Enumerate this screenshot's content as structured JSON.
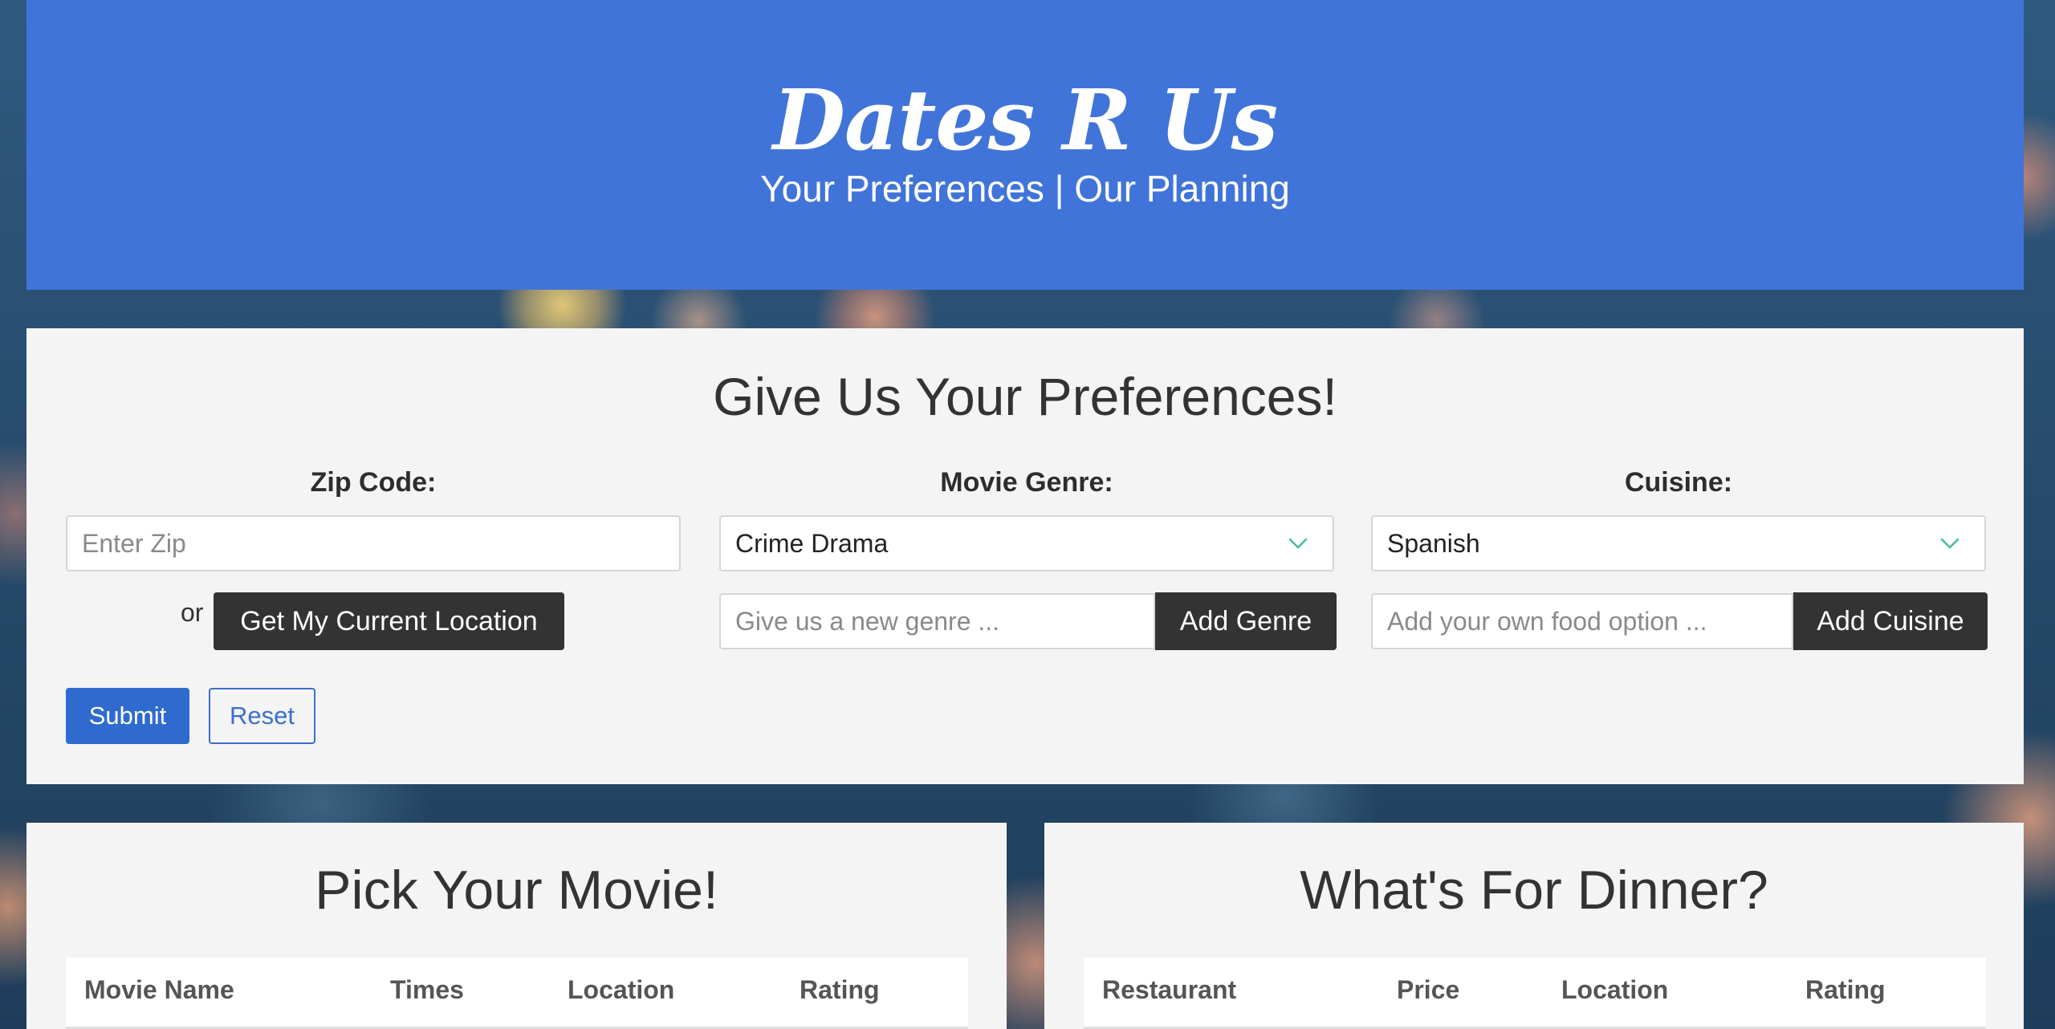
{
  "header": {
    "title": "Dates R Us",
    "subtitle": "Your Preferences | Our Planning"
  },
  "preferences": {
    "heading": "Give Us Your Preferences!",
    "zip": {
      "label": "Zip Code:",
      "placeholder": "Enter Zip",
      "or_text": "or",
      "location_button": "Get My Current Location"
    },
    "genre": {
      "label": "Movie Genre:",
      "selected": "Crime Drama",
      "new_placeholder": "Give us a new genre ...",
      "add_button": "Add Genre"
    },
    "cuisine": {
      "label": "Cuisine:",
      "selected": "Spanish",
      "new_placeholder": "Add your own food option ...",
      "add_button": "Add Cuisine"
    },
    "submit_label": "Submit",
    "reset_label": "Reset"
  },
  "movies": {
    "heading": "Pick Your Movie!",
    "columns": [
      "Movie Name",
      "Times",
      "Location",
      "Rating"
    ]
  },
  "dinner": {
    "heading": "What's For Dinner?",
    "columns": [
      "Restaurant",
      "Price",
      "Location",
      "Rating"
    ]
  },
  "colors": {
    "banner": "#4174d9",
    "primary": "#2f6bcf",
    "dark_button": "#333333",
    "panel": "#f4f4f4",
    "chevron": "#3fbf9f"
  },
  "icons": {
    "select_chevron": "chevron-down-icon"
  }
}
